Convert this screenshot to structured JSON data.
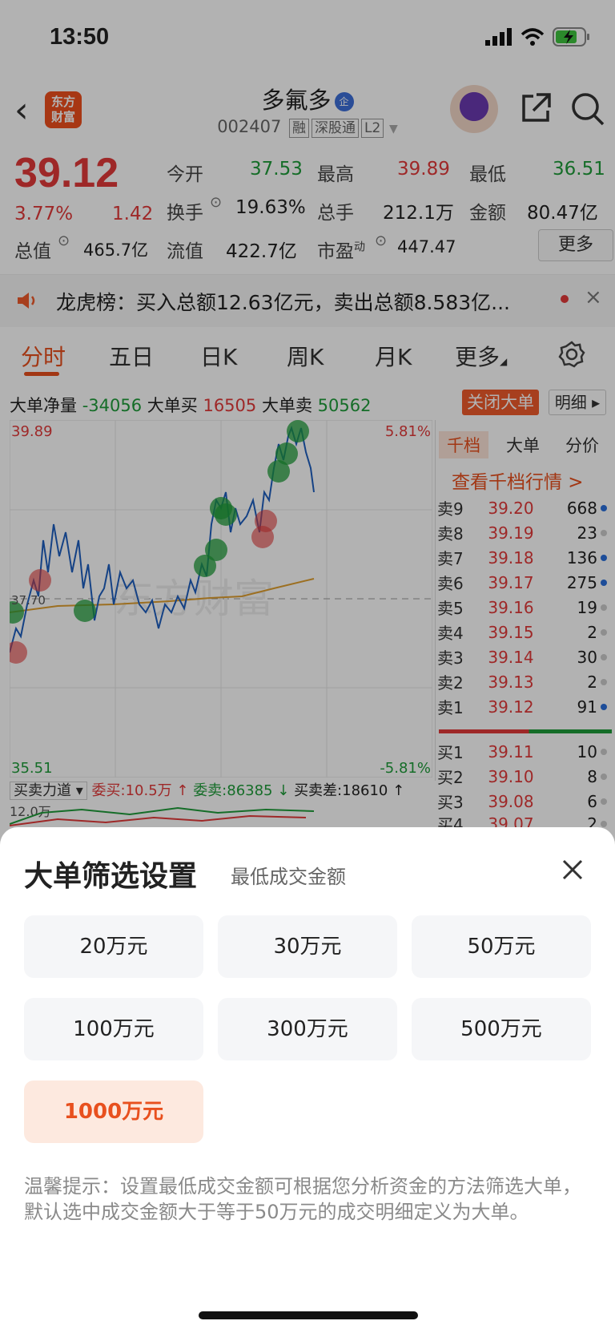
{
  "status": {
    "time": "13:50"
  },
  "header": {
    "logo_line1": "东方",
    "logo_line2": "财富",
    "stock_name": "多氟多",
    "enterprise_badge": "企",
    "stock_code": "002407",
    "badges": [
      "融",
      "深股通",
      "L2"
    ]
  },
  "quote": {
    "price": "39.12",
    "change_pct": "3.77%",
    "change": "1.42",
    "open_label": "今开",
    "open": "37.53",
    "high_label": "最高",
    "high": "39.89",
    "low_label": "最低",
    "low": "36.51",
    "turnover_label": "换手",
    "turnover": "19.63%",
    "volume_label": "总手",
    "volume": "212.1万",
    "amount_label": "金额",
    "amount": "80.47亿",
    "mktcap_label": "总值",
    "mktcap": "465.7亿",
    "float_label": "流值",
    "float_cap": "422.7亿",
    "pe_label": "市盈",
    "pe_sup": "动",
    "pe": "447.47",
    "more_label": "更多"
  },
  "notice": {
    "text": "龙虎榜：买入总额12.63亿元，卖出总额8.583亿..."
  },
  "tabs": [
    "分时",
    "五日",
    "日K",
    "周K",
    "月K",
    "更多"
  ],
  "big_order": {
    "net_label": "大单净量",
    "net": "-34056",
    "buy_label": "大单买",
    "buy": "16505",
    "sell_label": "大单卖",
    "sell": "50562",
    "close_btn": "关闭大单",
    "detail_btn": "明细"
  },
  "chart": {
    "top_price": "39.89",
    "mid_price": "37.70",
    "bottom_price": "35.51",
    "top_pct": "5.81%",
    "bottom_pct": "-5.81%",
    "watermark": "东方财富"
  },
  "orderbook": {
    "tabs": [
      "千档",
      "大单",
      "分价"
    ],
    "link": "查看千档行情 >",
    "asks": [
      {
        "label": "卖9",
        "price": "39.20",
        "vol": "668"
      },
      {
        "label": "卖8",
        "price": "39.19",
        "vol": "23"
      },
      {
        "label": "卖7",
        "price": "39.18",
        "vol": "136"
      },
      {
        "label": "卖6",
        "price": "39.17",
        "vol": "275"
      },
      {
        "label": "卖5",
        "price": "39.16",
        "vol": "19"
      },
      {
        "label": "卖4",
        "price": "39.15",
        "vol": "2"
      },
      {
        "label": "卖3",
        "price": "39.14",
        "vol": "30"
      },
      {
        "label": "卖2",
        "price": "39.13",
        "vol": "2"
      },
      {
        "label": "卖1",
        "price": "39.12",
        "vol": "91"
      }
    ],
    "bids": [
      {
        "label": "买1",
        "price": "39.11",
        "vol": "10"
      },
      {
        "label": "买2",
        "price": "39.10",
        "vol": "8"
      },
      {
        "label": "买3",
        "price": "39.08",
        "vol": "6"
      },
      {
        "label": "买4",
        "price": "39.07",
        "vol": "2"
      }
    ]
  },
  "force": {
    "select_label": "买卖力道",
    "entrust_buy": "委买:10.5万 ↑",
    "entrust_sell": "委卖:86385 ↓",
    "diff": "买卖差:18610 ↑",
    "axis": "12.0万"
  },
  "sheet": {
    "title": "大单筛选设置",
    "subtitle": "最低成交金额",
    "options": [
      "20万元",
      "30万元",
      "50万元",
      "100万元",
      "300万元",
      "500万元",
      "1000万元"
    ],
    "selected": "1000万元",
    "tip": "温馨提示：设置最低成交金额可根据您分析资金的方法筛选大单，默认选中成交金额大于等于50万元的成交明细定义为大单。"
  },
  "colors": {
    "up": "#e23a3a",
    "down": "#1f9d3a",
    "accent": "#e8501e"
  }
}
